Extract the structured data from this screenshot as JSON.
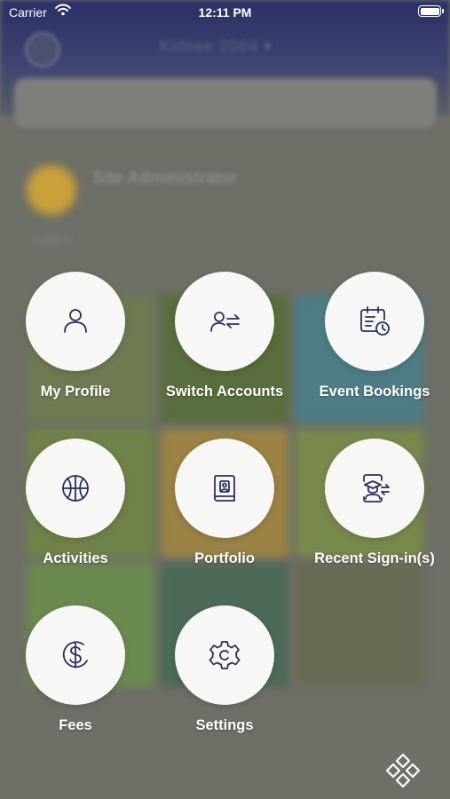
{
  "status_bar": {
    "carrier": "Carrier",
    "time": "12:11 PM"
  },
  "background": {
    "title": "Kidsee 2004 ▾",
    "admin_name": "Site Administrator",
    "subtitle": "Gallery"
  },
  "menu": {
    "items": [
      {
        "label": "My Profile",
        "icon": "user-icon"
      },
      {
        "label": "Switch Accounts",
        "icon": "switch-accounts-icon"
      },
      {
        "label": "Event Bookings",
        "icon": "calendar-clock-icon"
      },
      {
        "label": "Activities",
        "icon": "basketball-icon"
      },
      {
        "label": "Portfolio",
        "icon": "portfolio-book-icon"
      },
      {
        "label": "Recent Sign-in(s)",
        "icon": "student-switch-icon"
      },
      {
        "label": "Fees",
        "icon": "dollar-icon"
      },
      {
        "label": "Settings",
        "icon": "gear-icon"
      }
    ]
  },
  "colors": {
    "icon_stroke": "#2b2f5a",
    "circle_bg": "#f7f7f5",
    "label": "#ffffff"
  }
}
